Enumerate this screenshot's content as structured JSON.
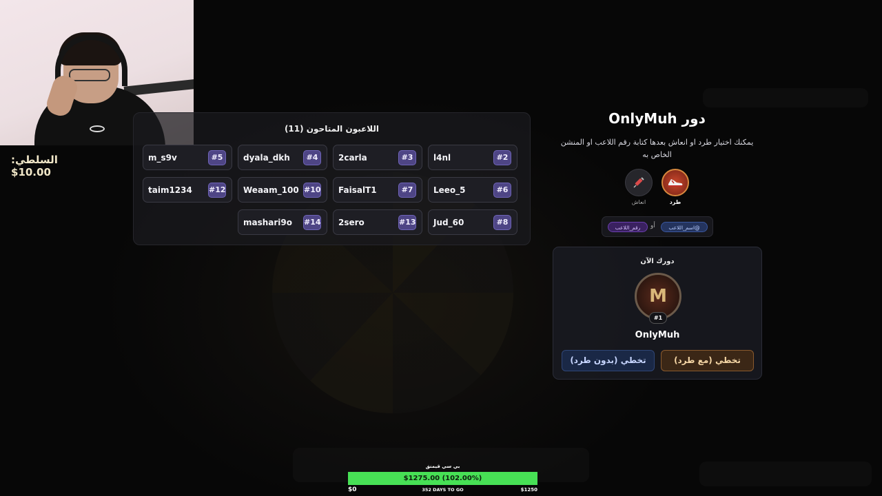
{
  "balance": "السلطي: 10.00$",
  "players_panel": {
    "title": "اللاعبون المتاحون (11)",
    "players": [
      {
        "name": "m_s9v",
        "num": "#5"
      },
      {
        "name": "dyala_dkh",
        "num": "#4"
      },
      {
        "name": "2carla",
        "num": "#3"
      },
      {
        "name": "l4nl",
        "num": "#2"
      },
      {
        "name": "taim1234",
        "num": "#12"
      },
      {
        "name": "Weaam_100",
        "num": "#10"
      },
      {
        "name": "FaisalT1",
        "num": "#7"
      },
      {
        "name": "Leeo_5",
        "num": "#6"
      },
      {
        "name": "mashari9o",
        "num": "#14"
      },
      {
        "name": "2sero",
        "num": "#13"
      },
      {
        "name": "Jud_60",
        "num": "#8"
      }
    ]
  },
  "turn": {
    "title": "دور OnlyMuh",
    "description": "يمكنك اختيار طرد او انعاش بعدها كتابة رقم اللاعب او المنشن الخاص به",
    "actions": [
      {
        "label": "طرد",
        "icon": "sneaker-icon"
      },
      {
        "label": "انعاش",
        "icon": "syringe-icon"
      }
    ],
    "mention_hint": {
      "name_chip": "@اسم_اللاعب",
      "or": "أو",
      "number_chip": "رقم_اللاعب"
    }
  },
  "current": {
    "title": "دورك الآن",
    "badge": "#1",
    "name": "OnlyMuh",
    "btn_with_kick": "تخطي (مع طرد)",
    "btn_without_kick": "تخطي (بدون طرد)"
  },
  "goal": {
    "title": "بي سي قيمنق",
    "progress_text": "$1275.00 (102.00%)",
    "progress_percent": 100,
    "min_label": "$0",
    "days_text": "352 DAYS TO GO",
    "max_label": "$1250"
  },
  "colors": {
    "accent_purple": "#4e4585",
    "goal_green": "#47e055",
    "kick_orange": "#c8472b"
  }
}
